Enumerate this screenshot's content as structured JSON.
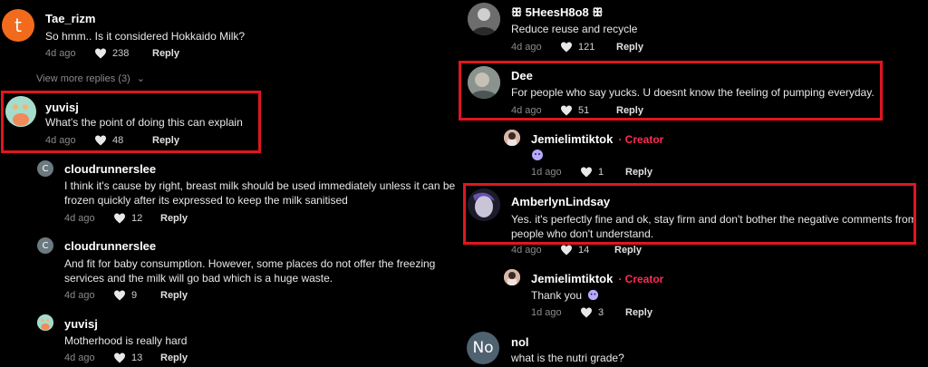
{
  "colors": {
    "accent_red": "#fe2c55",
    "highlight_box": "#e0161e",
    "background": "#000000"
  },
  "icons": {
    "like": "heart-icon",
    "expand": "chevron-down-icon"
  },
  "left": {
    "c1": {
      "avatar_letter": "t",
      "user": "Tae_rizm",
      "text": "So hmm.. Is it considered Hokkaido Milk?",
      "age": "4d ago",
      "likes": "238",
      "reply": "Reply"
    },
    "view_more": "View more replies (3)",
    "c2": {
      "user": "yuvisj",
      "text": "What's the point of doing this can explain",
      "age": "4d ago",
      "likes": "48",
      "reply": "Reply"
    },
    "c3": {
      "avatar_letter": "C",
      "user": "cloudrunnerslee",
      "text1": "I think it's cause by right, breast milk should be used immediately unless it can be",
      "text2": "frozen quickly after its expressed to keep the milk sanitised",
      "age": "4d ago",
      "likes": "12",
      "reply": "Reply"
    },
    "c4": {
      "avatar_letter": "C",
      "user": "cloudrunnerslee",
      "text1": "And fit for baby consumption. However, some places do not offer the freezing",
      "text2": "services and the milk will go bad which is a huge waste.",
      "age": "4d ago",
      "likes": "9",
      "reply": "Reply"
    },
    "c5": {
      "user": "yuvisj",
      "text": "Motherhood is really hard",
      "age": "4d ago",
      "likes": "13",
      "reply": "Reply"
    }
  },
  "right": {
    "c1": {
      "user": "ꕥ 5HeesH8o8 ꕥ",
      "text": "Reduce reuse and recycle",
      "age": "4d ago",
      "likes": "121",
      "reply": "Reply"
    },
    "c2": {
      "user": "Dee",
      "text": "For people who say yucks. U doesnt know the feeling of pumping everyday.",
      "age": "4d ago",
      "likes": "51",
      "reply": "Reply"
    },
    "c3": {
      "user": "Jemielimtiktok",
      "badge": "· Creator",
      "age": "1d ago",
      "likes": "1",
      "reply": "Reply"
    },
    "c4": {
      "user": "AmberlynLindsay",
      "text1": "Yes. it's perfectly fine and ok, stay firm and don't bother the negative comments from",
      "text2": "people who don't understand.",
      "age": "4d ago",
      "likes": "14",
      "reply": "Reply"
    },
    "c5": {
      "user": "Jemielimtiktok",
      "badge": "· Creator",
      "text": "Thank you",
      "age": "1d ago",
      "likes": "3",
      "reply": "Reply"
    },
    "c6": {
      "avatar_letter": "No",
      "user": "nol",
      "text": "what is the nutri grade?"
    }
  }
}
